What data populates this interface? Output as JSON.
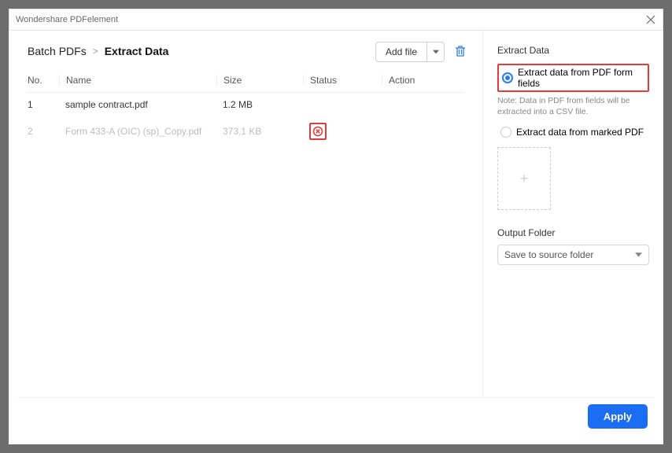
{
  "window": {
    "title": "Wondershare PDFelement"
  },
  "breadcrumb": {
    "root": "Batch PDFs",
    "sep": ">",
    "current": "Extract Data"
  },
  "toolbar": {
    "add_file": "Add file"
  },
  "table": {
    "headers": {
      "no": "No.",
      "name": "Name",
      "size": "Size",
      "status": "Status",
      "action": "Action"
    },
    "rows": [
      {
        "no": "1",
        "name": "sample contract.pdf",
        "size": "1.2 MB",
        "dim": false,
        "error": false
      },
      {
        "no": "2",
        "name": "Form 433-A (OIC) (sp)_Copy.pdf",
        "size": "373.1 KB",
        "dim": true,
        "error": true
      }
    ]
  },
  "side": {
    "title": "Extract Data",
    "opt_form": "Extract data from PDF form fields",
    "note": "Note: Data in PDF from fields will be extracted into a CSV file.",
    "opt_marked": "Extract data from marked PDF",
    "thumb_plus": "+",
    "output_title": "Output Folder",
    "output_value": "Save to source folder"
  },
  "footer": {
    "apply": "Apply"
  }
}
